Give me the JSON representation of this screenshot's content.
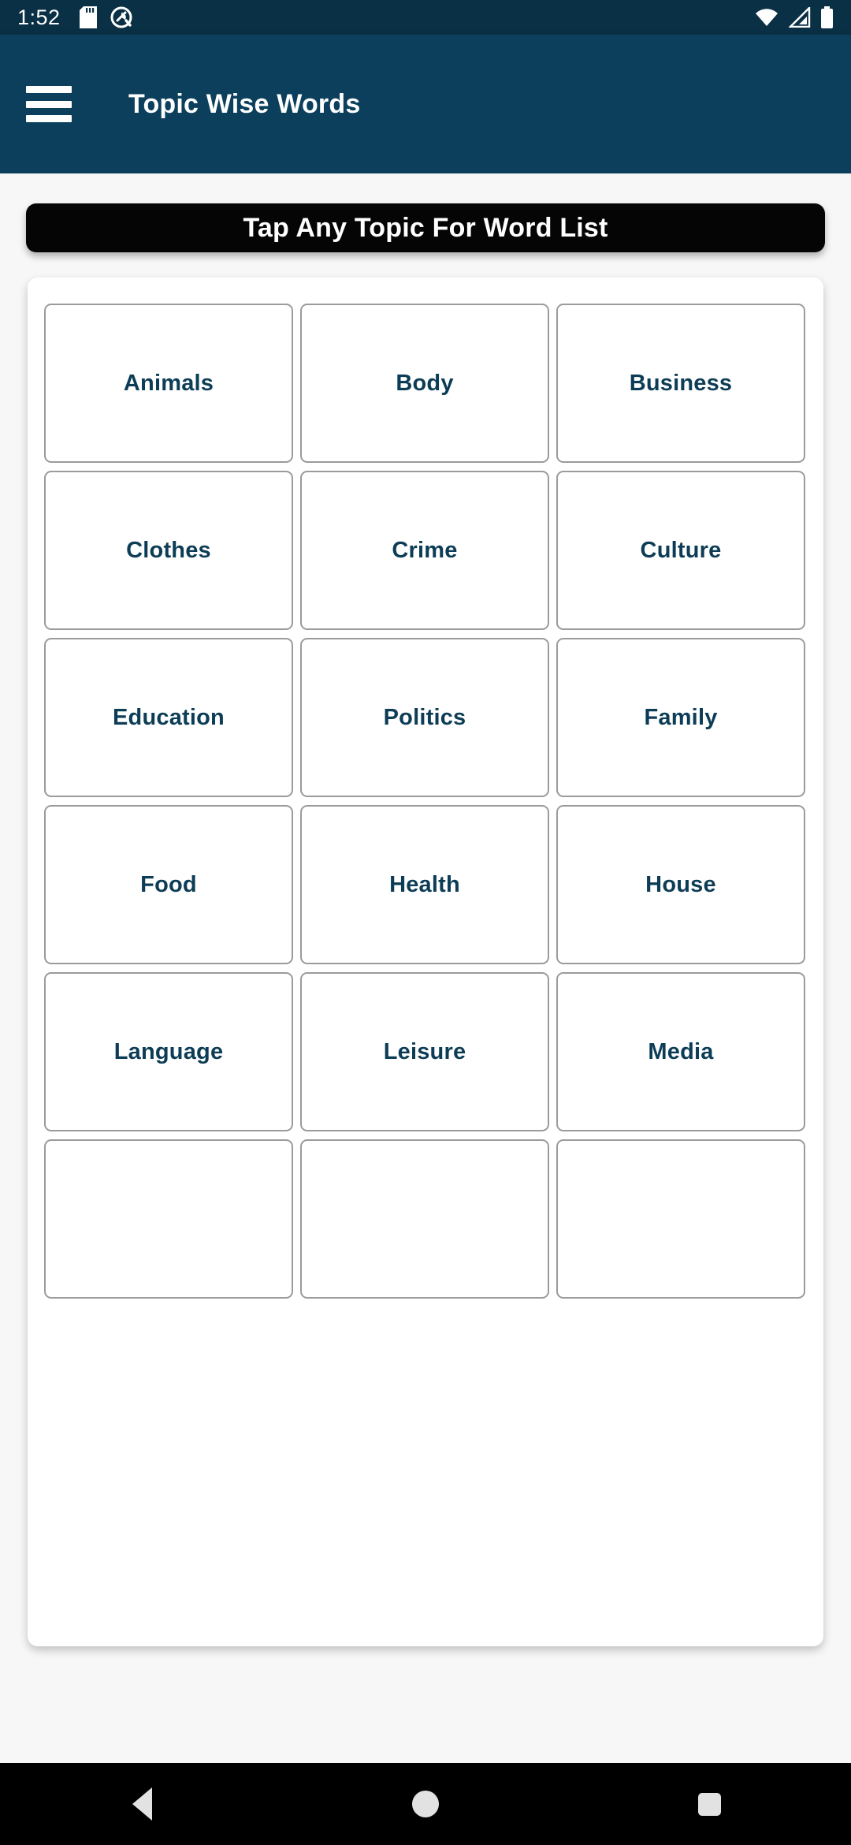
{
  "status_bar": {
    "time": "1:52",
    "left_icons": [
      "sd-card-icon",
      "do-not-disturb-icon"
    ],
    "right_icons": [
      "wifi-icon",
      "cellular-signal-icon",
      "battery-icon"
    ],
    "background_color": "#0a3045"
  },
  "app_bar": {
    "menu_icon": "hamburger-menu-icon",
    "title": "Topic Wise Words",
    "background_color": "#0b3f5c",
    "text_color": "#ffffff"
  },
  "banner": {
    "text": "Tap Any Topic For Word List",
    "background_color": "#050505",
    "text_color": "#ffffff"
  },
  "topics": {
    "accent_color": "#0d3d56",
    "border_color": "#9b9b9b",
    "items": [
      {
        "label": "Animals"
      },
      {
        "label": "Body"
      },
      {
        "label": "Business"
      },
      {
        "label": "Clothes"
      },
      {
        "label": "Crime"
      },
      {
        "label": "Culture"
      },
      {
        "label": "Education"
      },
      {
        "label": "Politics"
      },
      {
        "label": "Family"
      },
      {
        "label": "Food"
      },
      {
        "label": "Health"
      },
      {
        "label": "House"
      },
      {
        "label": "Language"
      },
      {
        "label": "Leisure"
      },
      {
        "label": "Media"
      },
      {
        "label": ""
      },
      {
        "label": ""
      },
      {
        "label": ""
      }
    ]
  },
  "nav_bar": {
    "background_color": "#000000",
    "buttons": [
      {
        "name": "back-button",
        "icon": "triangle-left-icon"
      },
      {
        "name": "home-button",
        "icon": "circle-icon"
      },
      {
        "name": "recents-button",
        "icon": "square-icon"
      }
    ]
  }
}
